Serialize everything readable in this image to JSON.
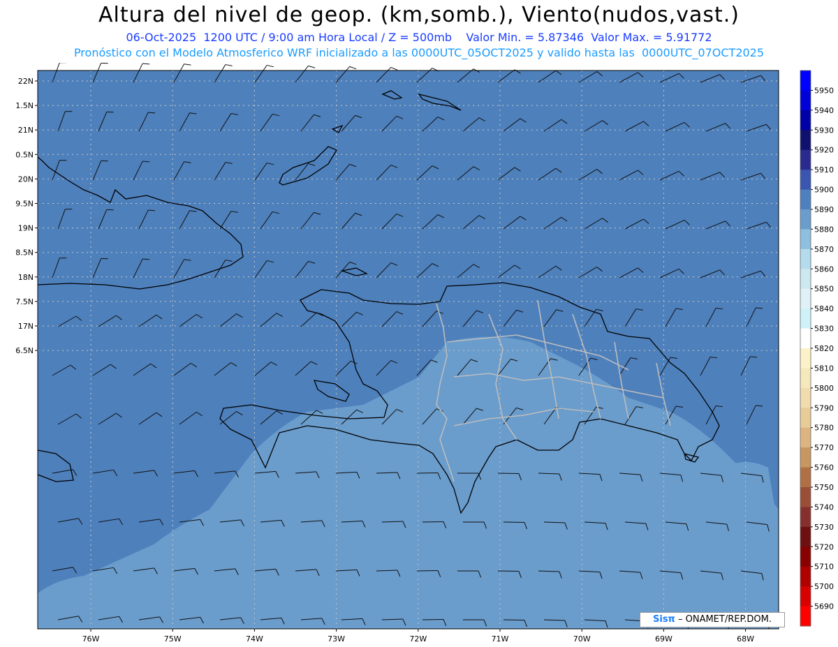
{
  "title": "Altura del nivel de geop. (km,somb.), Viento(nudos,vast.)",
  "subtitle": "06-Oct-2025  1200 UTC / 9:00 am Hora Local / Z = 500mb    Valor Min. = 5.87346  Valor Max. = 5.91772",
  "caption": "Pronóstico con el Modelo Atmosferico WRF inicializado a las 0000UTC_05OCT2025 y valido hasta las  0000UTC_07OCT2025",
  "credit": {
    "brand": "Sisπ",
    "text": " – ONAMET/REP.DOM."
  },
  "lat_labels": [
    "22N",
    "1.5N",
    "21N",
    "0.5N",
    "20N",
    "9.5N",
    "19N",
    "8.5N",
    "18N",
    "7.5N",
    "17N",
    "6.5N"
  ],
  "lat_values": [
    22,
    21.5,
    21,
    20.5,
    20,
    19.5,
    19,
    18.5,
    18,
    17.5,
    17,
    16.5
  ],
  "lon_labels": [
    "76W",
    "75W",
    "74W",
    "73W",
    "72W",
    "71W",
    "70W",
    "69W",
    "68W"
  ],
  "lon_values": [
    -76,
    -75,
    -74,
    -73,
    -72,
    -71,
    -70,
    -69,
    -68
  ],
  "colorbar": {
    "labels": [
      "5950",
      "5940",
      "5930",
      "5920",
      "5910",
      "5900",
      "5890",
      "5880",
      "5870",
      "5860",
      "5850",
      "5840",
      "5830",
      "5820",
      "5810",
      "5800",
      "5790",
      "5780",
      "5770",
      "5760",
      "5750",
      "5740",
      "5730",
      "5720",
      "5710",
      "5700",
      "5690"
    ],
    "colors": [
      "#0000ff",
      "#0000d8",
      "#0000a8",
      "#101070",
      "#2a2a90",
      "#3a56b0",
      "#4e80c0",
      "#6a9ccc",
      "#8ebfdf",
      "#b4dcec",
      "#cce8f0",
      "#dff1f6",
      "#cef2f8",
      "#ffffff",
      "#fbf2c8",
      "#f6e8bd",
      "#f0dcae",
      "#e8cc98",
      "#dcb480",
      "#c89660",
      "#b07046",
      "#9a4e38",
      "#86302e",
      "#6e1010",
      "#880000",
      "#b00000",
      "#d80000",
      "#ff0000"
    ]
  },
  "colors": {
    "field_dark": "#4e80bc",
    "field_light": "#6a9ccc",
    "land_border": "#000000",
    "province_border": "#bdbdbd"
  }
}
